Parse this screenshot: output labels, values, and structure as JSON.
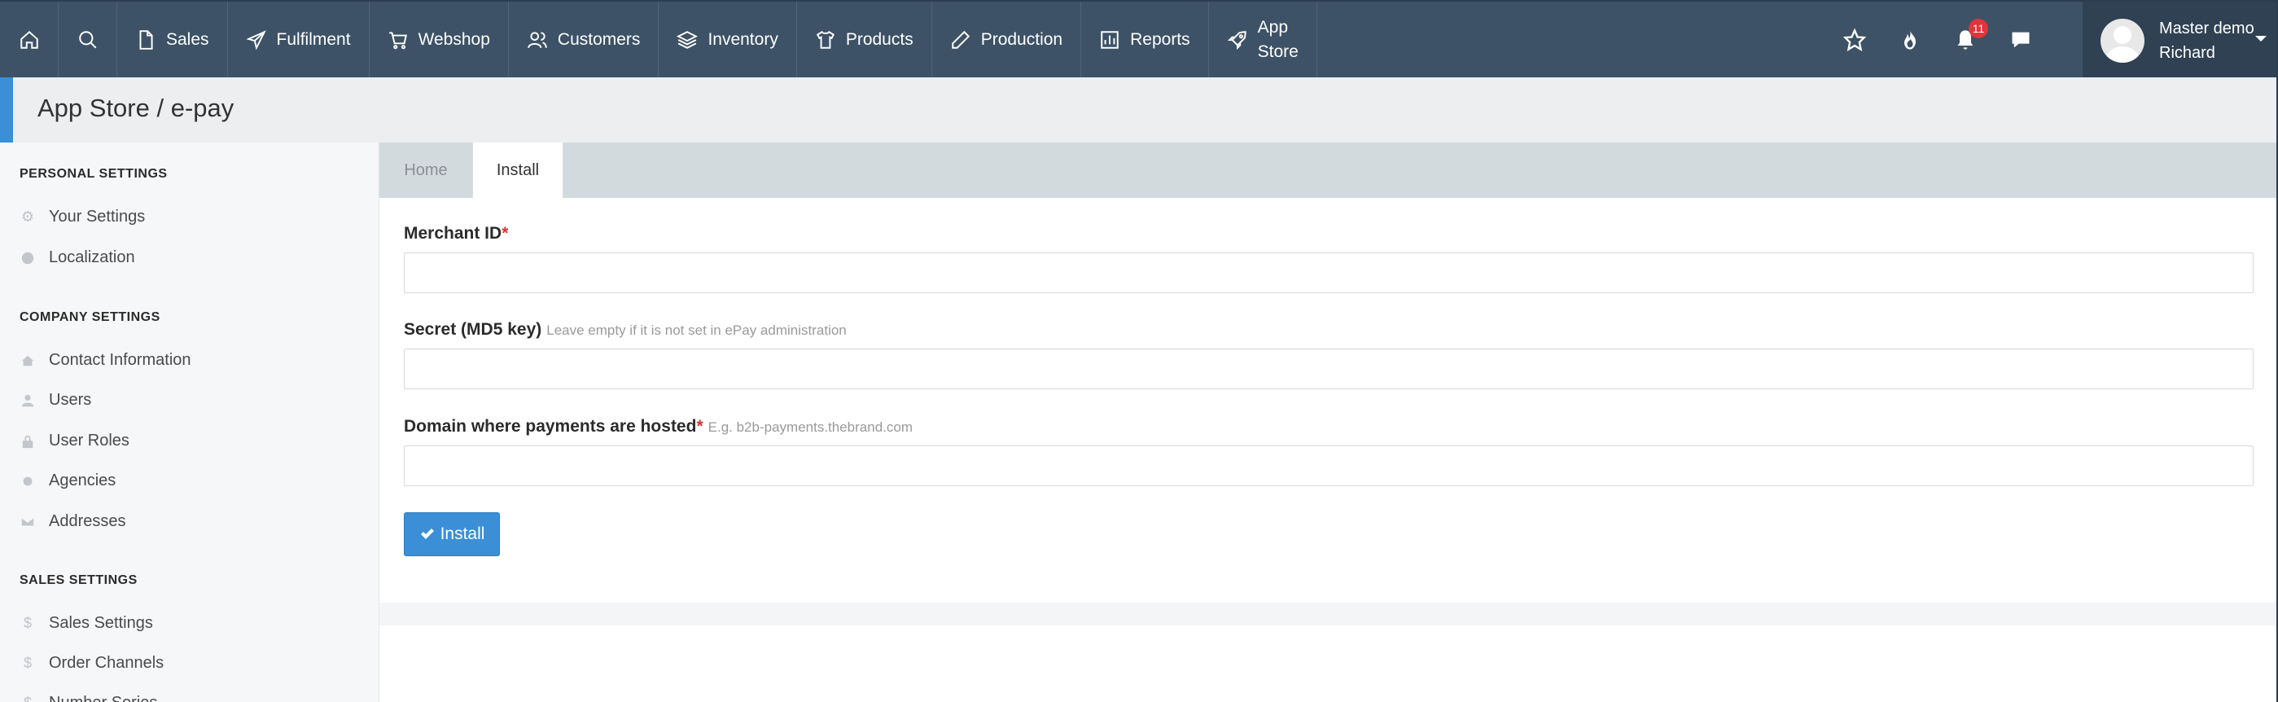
{
  "nav": {
    "items": [
      {
        "label": "Sales",
        "icon": "file-icon"
      },
      {
        "label": "Fulfilment",
        "icon": "paper-plane-icon"
      },
      {
        "label": "Webshop",
        "icon": "cart-icon"
      },
      {
        "label": "Customers",
        "icon": "users-icon"
      },
      {
        "label": "Inventory",
        "icon": "layers-icon"
      },
      {
        "label": "Products",
        "icon": "shirt-icon"
      },
      {
        "label": "Production",
        "icon": "pencil-icon"
      },
      {
        "label": "Reports",
        "icon": "bar-chart-icon"
      }
    ],
    "appstore_line1": "App",
    "appstore_line2": "Store",
    "notifications_count": "11",
    "user_line1": "Master demo",
    "user_line2": "Richard"
  },
  "page": {
    "title": "App Store / e-pay"
  },
  "sidebar": {
    "personal_heading": "PERSONAL SETTINGS",
    "personal_items": [
      "Your Settings",
      "Localization"
    ],
    "company_heading": "COMPANY SETTINGS",
    "company_items": [
      "Contact Information",
      "Users",
      "User Roles",
      "Agencies",
      "Addresses"
    ],
    "sales_heading": "SALES SETTINGS",
    "sales_items": [
      "Sales Settings",
      "Order Channels",
      "Number Series"
    ]
  },
  "tabs": [
    "Home",
    "Install"
  ],
  "form": {
    "merchant_label": "Merchant ID",
    "secret_label": "Secret (MD5 key)",
    "secret_hint": "Leave empty if it is not set in ePay administration",
    "domain_label": "Domain where payments are hosted",
    "domain_hint": "E.g. b2b-payments.thebrand.com",
    "required_mark": "*",
    "merchant_value": "",
    "secret_value": "",
    "domain_value": "",
    "install_label": "Install"
  },
  "colors": {
    "nav_bg": "#3d5266",
    "accent": "#3a8fd6",
    "badge": "#e0353a"
  }
}
